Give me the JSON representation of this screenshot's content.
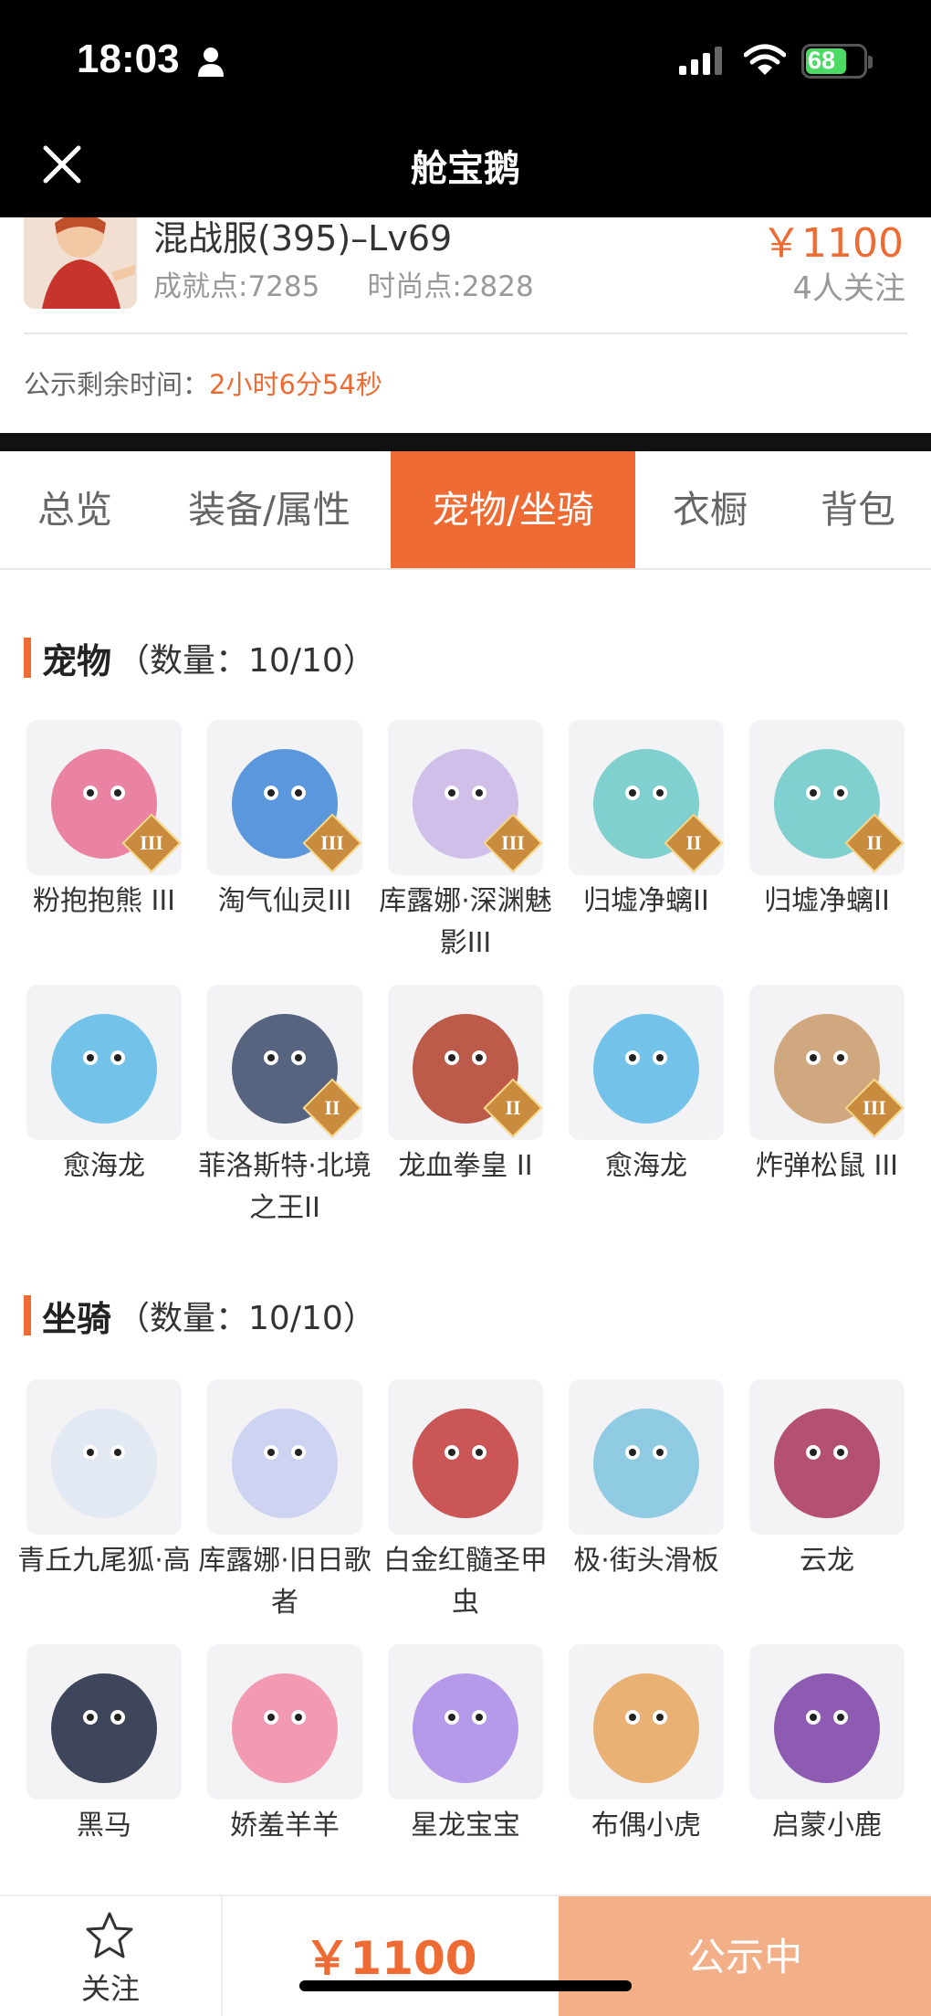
{
  "status_bar": {
    "time": "18:03",
    "battery": "68"
  },
  "nav": {
    "title": "舱宝鹅"
  },
  "header": {
    "server": "混战服(395)–Lv69",
    "achievement": "成就点:7285",
    "fashion": "时尚点:2828",
    "price": "￥1100",
    "followers": "4人关注",
    "countdown_label": "公示剩余时间：",
    "countdown_value": "2小时6分54秒"
  },
  "tabs": [
    {
      "label": "总览"
    },
    {
      "label": "装备/属性"
    },
    {
      "label": "宠物/坐骑"
    },
    {
      "label": "衣橱"
    },
    {
      "label": "背包"
    }
  ],
  "pets": {
    "title": "宠物",
    "count": "（数量：10/10）",
    "items": [
      {
        "name": "粉抱抱熊 III",
        "tier": "III",
        "color": "#e86f92"
      },
      {
        "name": "淘气仙灵III",
        "tier": "III",
        "color": "#3e86d8"
      },
      {
        "name": "库露娜·深渊魅影III",
        "tier": "III",
        "color": "#c9b6e6"
      },
      {
        "name": "归墟净螭II",
        "tier": "II",
        "color": "#6cc9c9"
      },
      {
        "name": "归墟净螭II",
        "tier": "II",
        "color": "#6cc9c9"
      },
      {
        "name": "愈海龙",
        "tier": "",
        "color": "#5bb8e6"
      },
      {
        "name": "菲洛斯特·北境之王II",
        "tier": "II",
        "color": "#3b4a6b"
      },
      {
        "name": "龙血拳皇 II",
        "tier": "II",
        "color": "#b2402c"
      },
      {
        "name": "愈海龙",
        "tier": "",
        "color": "#5bb8e6"
      },
      {
        "name": "炸弹松鼠 III",
        "tier": "III",
        "color": "#c99a6a"
      }
    ]
  },
  "mounts": {
    "title": "坐骑",
    "count": "（数量：10/10）",
    "items": [
      {
        "name": "青丘九尾狐·高",
        "color": "#dfe6f2"
      },
      {
        "name": "库露娜·旧日歌者",
        "color": "#c7cdf0"
      },
      {
        "name": "白金红髓圣甲虫",
        "color": "#c23a3a"
      },
      {
        "name": "极·街头滑板",
        "color": "#7cc3de"
      },
      {
        "name": "云龙",
        "color": "#a8345a"
      },
      {
        "name": "黑马",
        "color": "#1f2640"
      },
      {
        "name": "娇羞羊羊",
        "color": "#f08aa4"
      },
      {
        "name": "星龙宝宝",
        "color": "#a98ae6"
      },
      {
        "name": "布偶小虎",
        "color": "#e8a45e"
      },
      {
        "name": "启蒙小鹿",
        "color": "#7a3fa6"
      }
    ]
  },
  "bottom": {
    "follow_label": "关注",
    "price": "￥1100",
    "status": "公示中"
  },
  "colors": {
    "accent": "#ef6b34",
    "status_button": "#f3b088"
  }
}
